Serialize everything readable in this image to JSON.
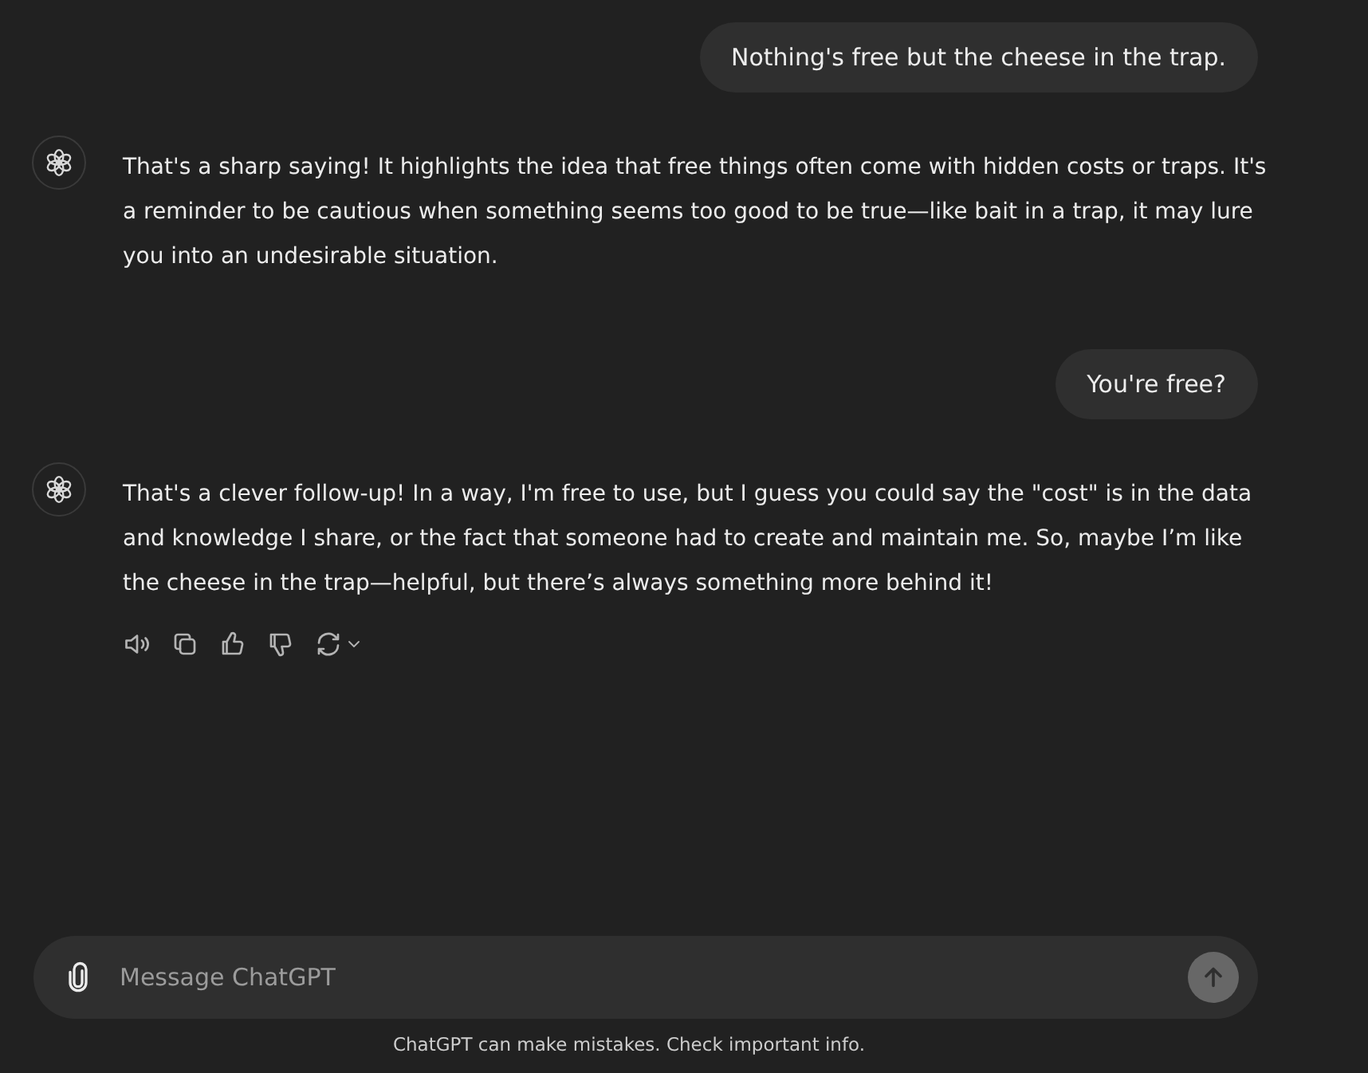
{
  "messages": [
    {
      "kind": "user",
      "text": "Nothing's free but the cheese in the trap."
    },
    {
      "kind": "assistant",
      "text": "That's a sharp saying! It highlights the idea that free things often come with hidden costs or traps. It's a reminder to be cautious when something seems too good to be true—like bait in a trap, it may lure you into an undesirable situation.",
      "actions_visible": false
    },
    {
      "kind": "user",
      "text": "You're free?"
    },
    {
      "kind": "assistant",
      "text": "That's a clever follow-up! In a way, I'm free to use, but I guess you could say the \"cost\" is in the data and knowledge I share, or the fact that someone had to create and maintain me. So, maybe I’m like the cheese in the trap—helpful, but there’s always something more behind it!",
      "actions_visible": true
    }
  ],
  "composer": {
    "placeholder": "Message ChatGPT"
  },
  "disclaimer": "ChatGPT can make mistakes. Check important info."
}
